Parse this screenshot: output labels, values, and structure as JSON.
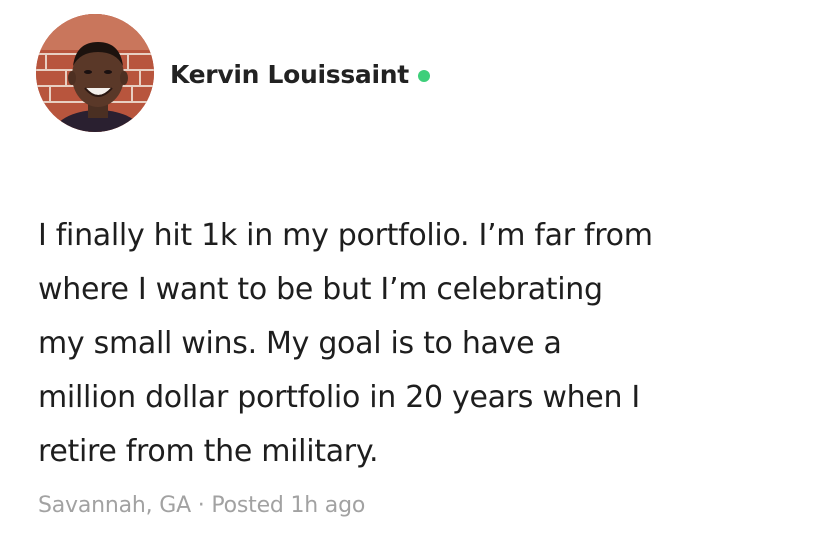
{
  "author": {
    "name": "Kervin Louissaint",
    "status": "online",
    "status_color": "#3ecf7a",
    "avatar_icon": "profile-photo"
  },
  "post": {
    "lines": [
      "I finally hit 1k in my portfolio. I’m far from",
      "where I want to be but I’m celebrating",
      "my small wins. My goal is to have a",
      "million dollar portfolio in 20 years when I",
      "retire from the military."
    ],
    "location": "Savannah, GA",
    "separator": "·",
    "posted": "Posted 1h ago"
  }
}
